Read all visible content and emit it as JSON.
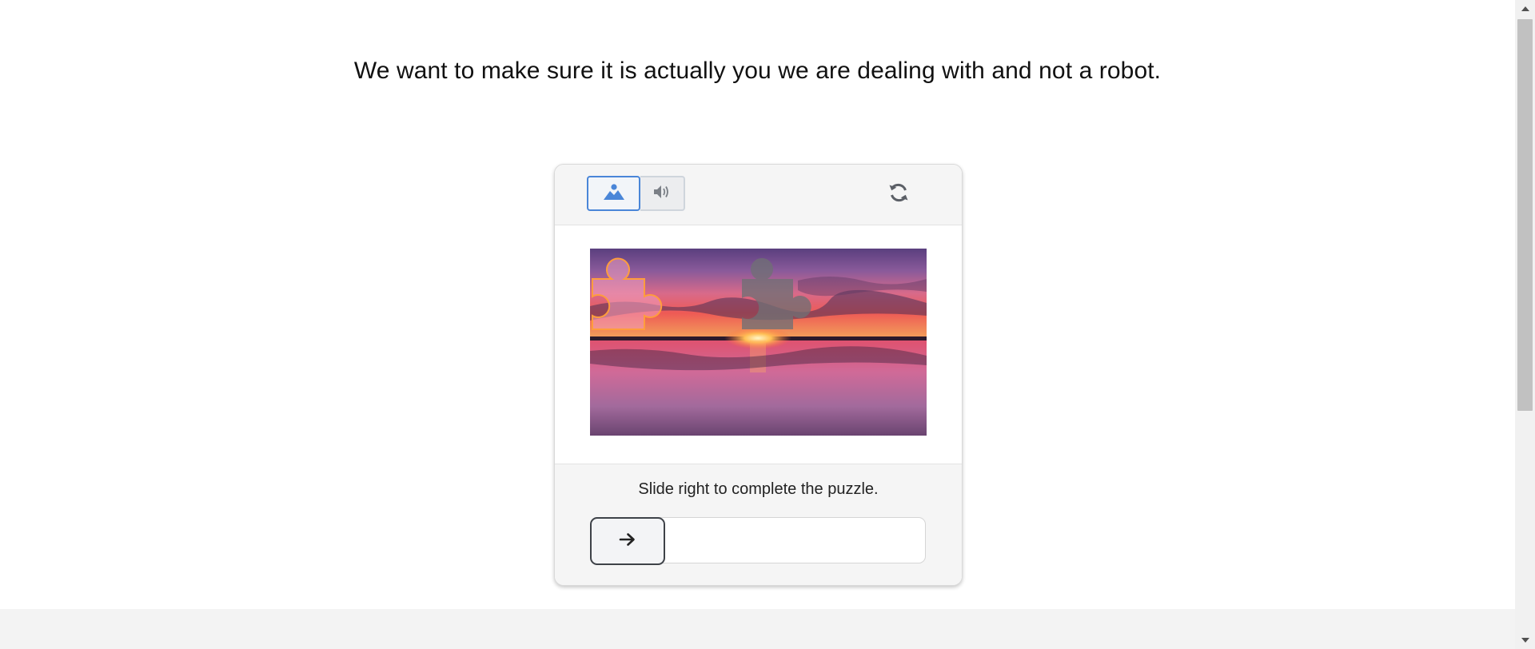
{
  "page": {
    "headline": "We want to make sure it is actually you we are dealing with and not a robot.",
    "footer_text": ""
  },
  "captcha": {
    "modes": [
      {
        "name": "image",
        "icon": "image-icon",
        "selected": true
      },
      {
        "name": "audio",
        "icon": "speaker-icon",
        "selected": false
      }
    ],
    "refresh_icon": "refresh-icon",
    "puzzle_image_alt": "sunset-over-water",
    "instruction": "Slide right to complete the puzzle.",
    "slider": {
      "icon": "arrow-right-icon",
      "position": 0
    }
  },
  "colors": {
    "accent": "#4a86d8",
    "handle_border": "#3e4248",
    "panel_bg": "#f5f5f5"
  }
}
